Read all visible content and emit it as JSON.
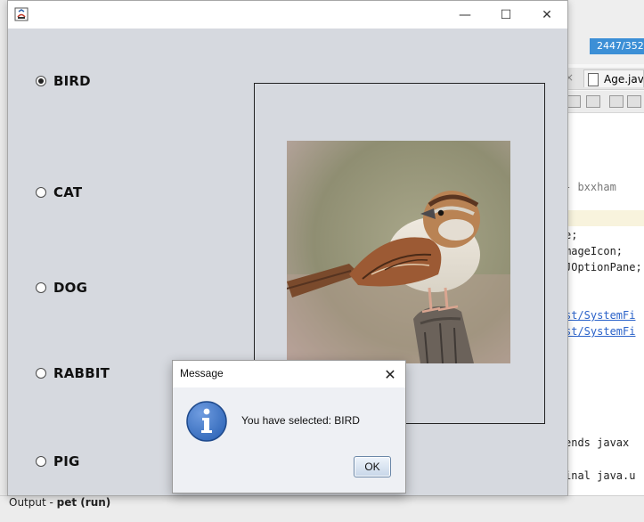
{
  "ide": {
    "status_chip": "2447/352",
    "editor_tab": "Age.java",
    "code_lines": [
      "- bxxham",
      "e;",
      "mageIcon;",
      "JOptionPane;",
      "st/SystemFi",
      "st/SystemFi",
      "ends javax",
      "inal java.u"
    ],
    "output_prefix": "Output - ",
    "output_run": "pet (run)"
  },
  "window": {
    "controls": {
      "minimize": "—",
      "maximize": "☐",
      "close": "✕"
    },
    "options": [
      {
        "label": "BIRD",
        "selected": true
      },
      {
        "label": "CAT",
        "selected": false
      },
      {
        "label": "DOG",
        "selected": false
      },
      {
        "label": "RABBIT",
        "selected": false
      },
      {
        "label": "PIG",
        "selected": false
      }
    ]
  },
  "dialog": {
    "title": "Message",
    "message": "You have selected: BIRD",
    "ok_label": "OK",
    "close": "✕",
    "icon": "information-icon"
  },
  "colors": {
    "window_bg": "#d6d9df",
    "accent": "#3c8fd6",
    "info_icon": "#2f66b8"
  }
}
